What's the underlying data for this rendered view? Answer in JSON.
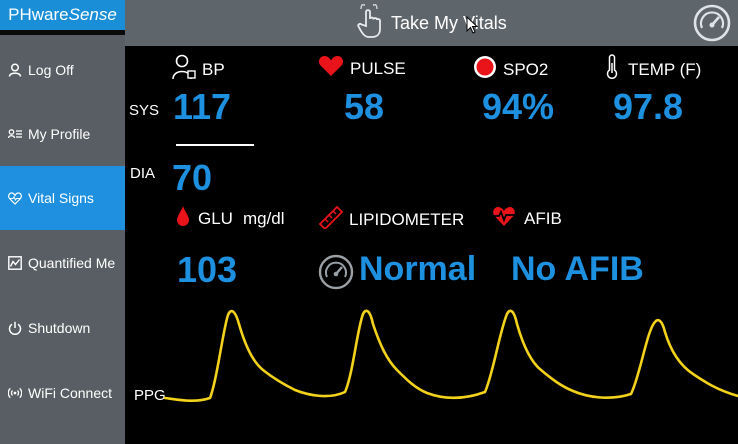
{
  "brand": {
    "prefix": "PHware",
    "suffix": "Sense"
  },
  "sidebar": {
    "items": [
      {
        "label": "Log Off",
        "icon": "person-icon"
      },
      {
        "label": "My Profile",
        "icon": "profile-list-icon"
      },
      {
        "label": "Vital Signs",
        "icon": "heartbeat-icon",
        "active": true
      },
      {
        "label": "Quantified Me",
        "icon": "chart-icon"
      },
      {
        "label": "Shutdown",
        "icon": "power-icon"
      },
      {
        "label": "WiFi Connect",
        "icon": "wifi-icon"
      }
    ]
  },
  "header": {
    "take_vitals_label": "Take My Vitals",
    "gauge_icon": "speedometer-icon"
  },
  "vitals": {
    "bp_label": "BP",
    "pulse_label": "PULSE",
    "spo2_label": "SPO2",
    "temp_label": "TEMP (F)",
    "sys_label": "SYS",
    "dia_label": "DIA",
    "sys_value": "117",
    "pulse_value": "58",
    "spo2_value": "94%",
    "temp_value": "97.8",
    "dia_value": "70",
    "glu_label": "GLU",
    "glu_unit": "mg/dl",
    "lipidometer_label": "LIPIDOMETER",
    "afib_label": "AFIB",
    "glu_value": "103",
    "lipid_value": "Normal",
    "afib_value": "No AFIB",
    "ppg_label": "PPG"
  },
  "colors": {
    "accent": "#1e90e0",
    "sidebar": "#585e63",
    "topbar": "#5f666b",
    "ppg": "#f2d21b",
    "alert_red": "#e8141a"
  }
}
